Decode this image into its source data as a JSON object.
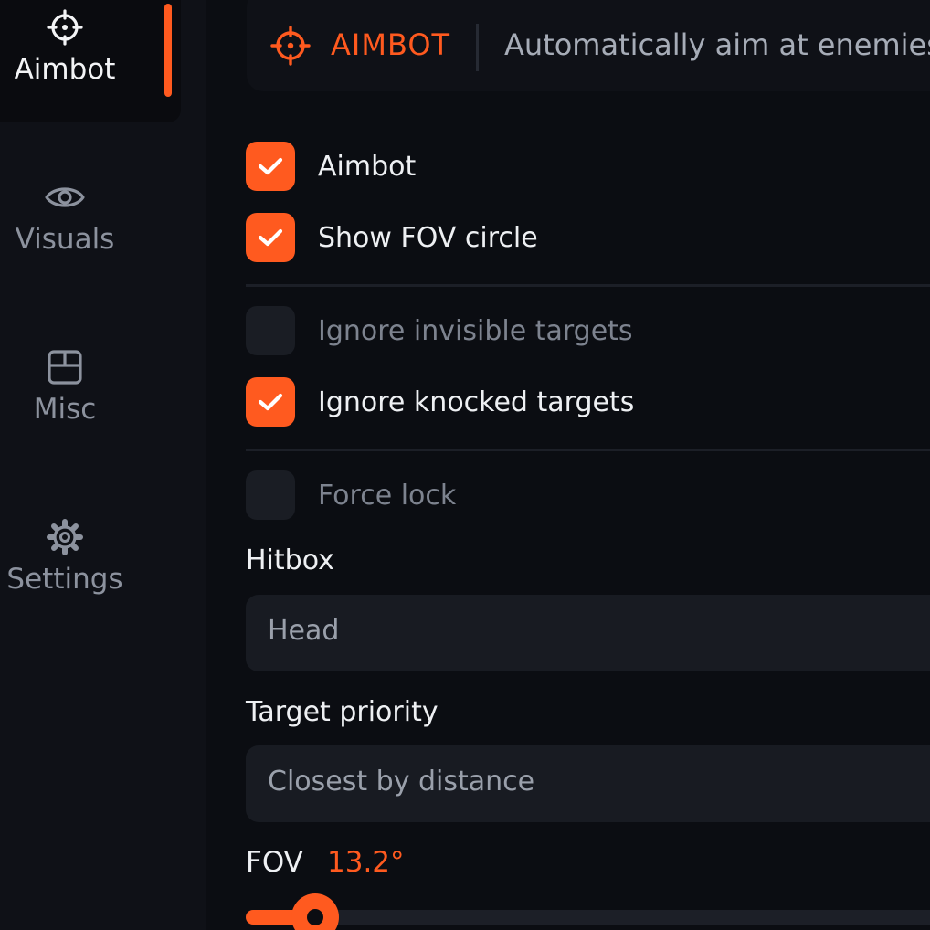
{
  "sidebar": {
    "items": [
      {
        "label": "Aimbot",
        "icon": "crosshair-icon",
        "active": true
      },
      {
        "label": "Visuals",
        "icon": "eye-icon",
        "active": false
      },
      {
        "label": "Misc",
        "icon": "box-icon",
        "active": false
      },
      {
        "label": "Settings",
        "icon": "gear-icon",
        "active": false
      }
    ]
  },
  "header": {
    "icon": "crosshair-icon",
    "title": "AIMBOT",
    "description": "Automatically aim at enemies"
  },
  "options": {
    "aimbot": {
      "label": "Aimbot",
      "checked": true
    },
    "show_fov": {
      "label": "Show FOV circle",
      "checked": true
    },
    "ignore_invisible": {
      "label": "Ignore invisible targets",
      "checked": false
    },
    "ignore_knocked": {
      "label": "Ignore knocked targets",
      "checked": true
    },
    "force_lock": {
      "label": "Force lock",
      "checked": false
    }
  },
  "hitbox": {
    "label": "Hitbox",
    "value": "Head"
  },
  "target_priority": {
    "label": "Target priority",
    "value": "Closest by distance"
  },
  "fov": {
    "label": "FOV",
    "value_text": "13.2°",
    "fill_fraction": 0.1
  },
  "colors": {
    "accent": "#ff5a1f",
    "background": "#0b0d12"
  }
}
